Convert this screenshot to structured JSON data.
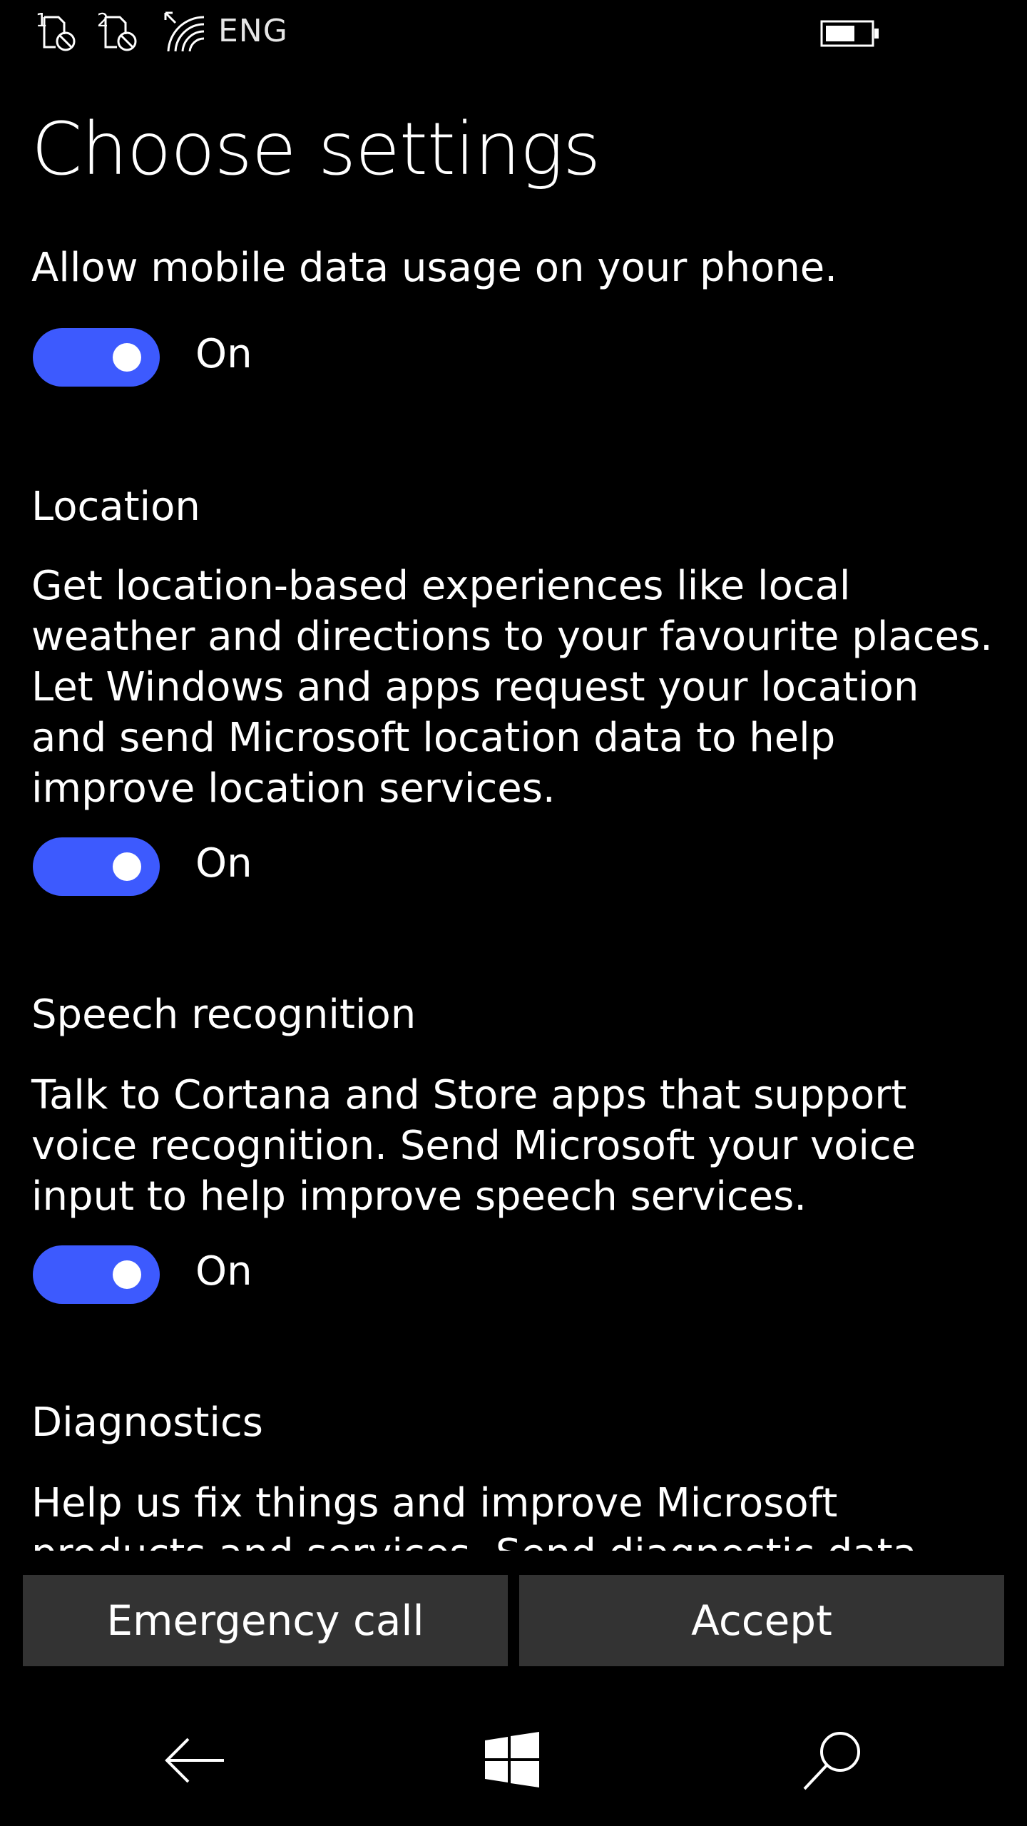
{
  "status_bar": {
    "sim1_label": "1",
    "sim2_label": "2",
    "language": "ENG",
    "icons": [
      "sim-1-no-service-icon",
      "sim-2-no-service-icon",
      "wifi-icon",
      "battery-icon"
    ]
  },
  "page": {
    "title": "Choose settings"
  },
  "sections": {
    "mobile_data": {
      "description": "Allow mobile data usage on your phone.",
      "toggle_state": "On",
      "toggle_on": true
    },
    "location": {
      "heading": "Location",
      "description": "Get location-based experiences like local weather and directions to your favourite places. Let Windows and apps request your location and send Microsoft location data to help improve location services.",
      "toggle_state": "On",
      "toggle_on": true
    },
    "speech": {
      "heading": "Speech recognition",
      "description": "Talk to Cortana and Store apps that support voice recognition. Send Microsoft your voice input to help improve speech services.",
      "toggle_state": "On",
      "toggle_on": true
    },
    "diagnostics": {
      "heading": "Diagnostics",
      "description": "Help us fix things and improve Microsoft products and services. Send diagnostic data (including"
    }
  },
  "buttons": {
    "emergency_call": "Emergency call",
    "accept": "Accept"
  },
  "nav": {
    "icons": [
      "back-arrow-icon",
      "windows-start-icon",
      "search-icon"
    ]
  },
  "colors": {
    "background": "#000000",
    "accent": "#3d5afe",
    "button_bg": "#333333",
    "text": "#ffffff"
  }
}
